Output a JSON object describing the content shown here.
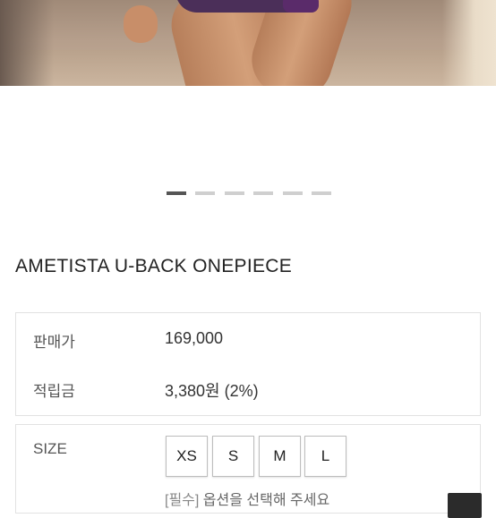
{
  "gallery": {
    "slide_count": 6,
    "active_index": 0
  },
  "product": {
    "name": "AMETISTA U-BACK ONEPIECE"
  },
  "info": {
    "price_label": "판매가",
    "price_value": "169,000",
    "points_label": "적립금",
    "points_value": "3,380원 (2%)"
  },
  "options": {
    "size_label": "SIZE",
    "sizes": [
      "XS",
      "S",
      "M",
      "L"
    ],
    "required_tag": "[필수]",
    "required_text": "옵션을 선택해 주세요"
  },
  "colors": {
    "active_dot": "#555555",
    "inactive_dot": "#cfcfcf"
  }
}
